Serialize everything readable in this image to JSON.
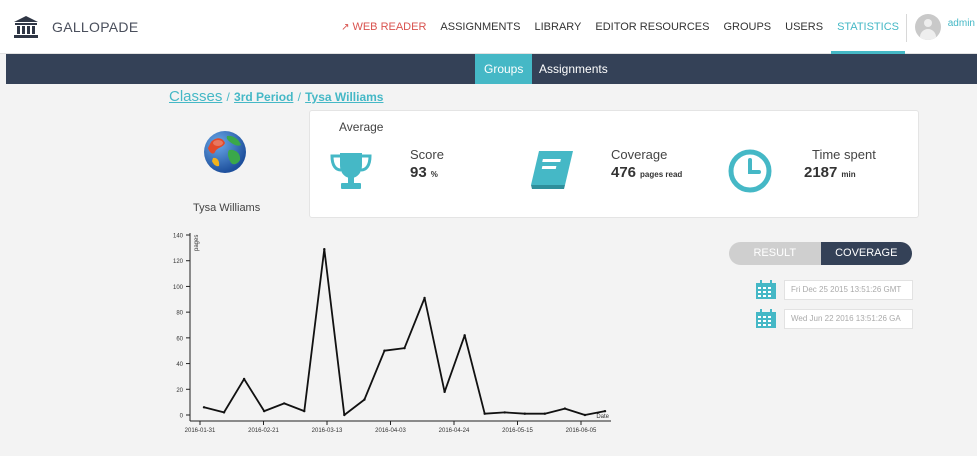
{
  "brand": {
    "name": "GALLOPADE"
  },
  "nav": {
    "web_reader": "WEB READER",
    "assignments": "ASSIGNMENTS",
    "library": "LIBRARY",
    "editor_resources": "EDITOR RESOURCES",
    "groups": "GROUPS",
    "users": "USERS",
    "statistics": "STATISTICS",
    "active": "STATISTICS",
    "user": "admin"
  },
  "subnav": {
    "groups": "Groups",
    "assignments": "Assignments",
    "active": "Groups"
  },
  "breadcrumb": {
    "classes": "Classes",
    "sep1": "/",
    "period": "3rd Period",
    "sep2": "/",
    "student": "Tysa Williams"
  },
  "student": {
    "name": "Tysa Williams"
  },
  "average": {
    "title": "Average",
    "score": {
      "label": "Score",
      "value": "93",
      "unit": "%"
    },
    "coverage": {
      "label": "Coverage",
      "value": "476",
      "unit": "pages read"
    },
    "time": {
      "label": "Time spent",
      "value": "2187",
      "unit": "min"
    }
  },
  "toggle": {
    "result": "RESULT",
    "coverage": "COVERAGE",
    "active": "COVERAGE"
  },
  "dates": {
    "from": "Fri Dec 25 2015 13:51:26 GMT",
    "to": "Wed Jun 22 2016 13:51:26 GA"
  },
  "colors": {
    "accent": "#45b8c6",
    "dark": "#344157",
    "web_reader": "#d9534f"
  },
  "chart_data": {
    "type": "line",
    "xlabel": "Date",
    "ylabel": "pages",
    "ylim": [
      0,
      140
    ],
    "yticks": [
      0,
      20,
      40,
      60,
      80,
      100,
      120,
      140
    ],
    "x_ticks": [
      "2016-01-31",
      "2016-02-21",
      "2016-03-13",
      "2016-04-03",
      "2016-04-24",
      "2016-05-15",
      "2016-06-05"
    ],
    "series": [
      {
        "values": [
          6,
          2,
          28,
          3,
          9,
          3,
          129,
          0,
          12,
          50,
          52,
          91,
          18,
          62,
          1,
          2,
          1,
          1,
          5,
          0,
          3
        ]
      }
    ]
  }
}
